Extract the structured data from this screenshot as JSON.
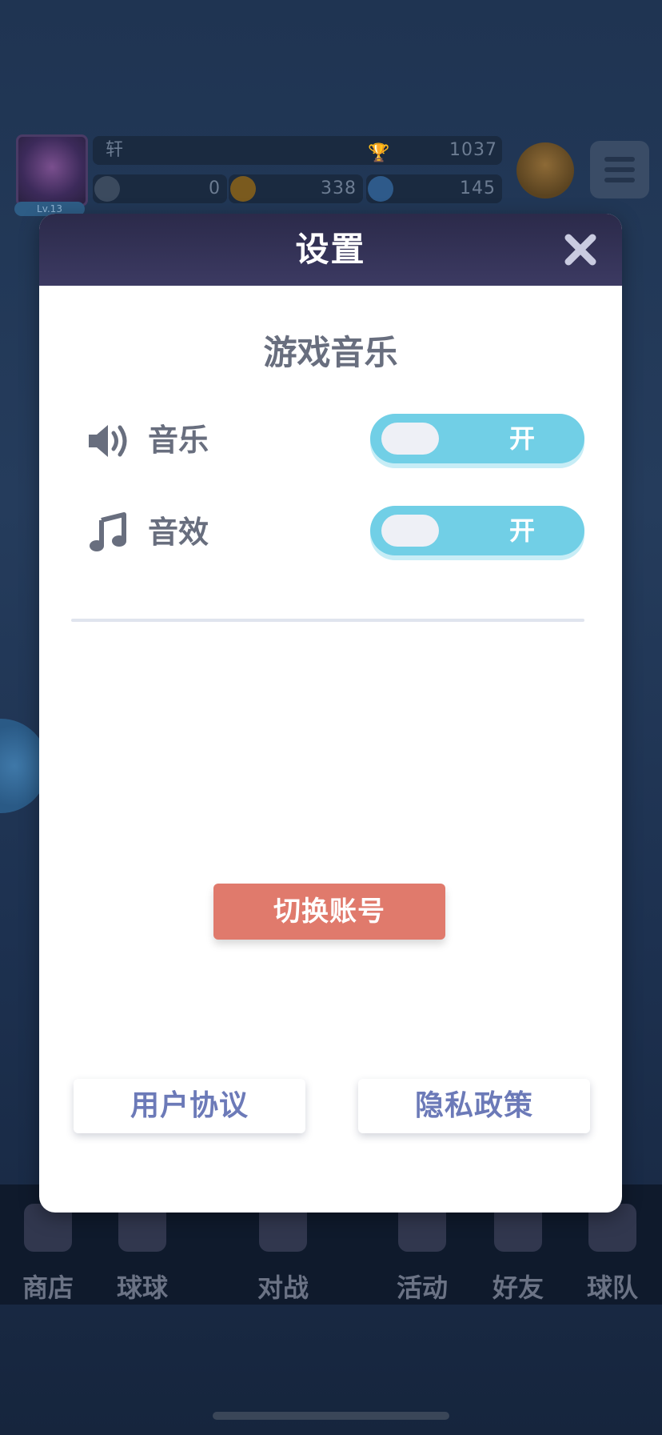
{
  "background": {
    "player_name": "轩",
    "level_label": "Lv.13",
    "trophy_score": "1037",
    "resources": [
      "0",
      "338",
      "145"
    ],
    "bottom_nav": [
      "商店",
      "球球",
      "对战",
      "活动",
      "好友",
      "球队"
    ]
  },
  "dialog": {
    "title": "设置",
    "section_title": "游戏音乐",
    "settings": [
      {
        "label": "音乐",
        "icon": "speaker-icon",
        "state": "开"
      },
      {
        "label": "音效",
        "icon": "music-note-icon",
        "state": "开"
      }
    ],
    "switch_account_label": "切换账号",
    "user_agreement_label": "用户协议",
    "privacy_policy_label": "隐私政策"
  },
  "colors": {
    "header": "#3c3a62",
    "toggle_on": "#71cfe6",
    "switch_button": "#e07a6c",
    "link_text": "#6c7ab8",
    "label_text": "#686e7e"
  }
}
